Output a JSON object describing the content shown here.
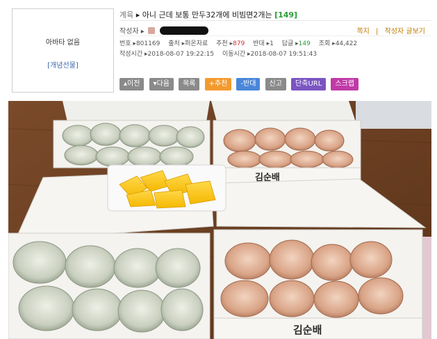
{
  "post": {
    "avatar": {
      "no_avatar": "아바타 없음",
      "gift": "[개념선물]"
    },
    "category": "계육",
    "title": "아니 근데 보통 만두32개에 비빔면2개는",
    "comment_count": "[149]",
    "author_label": "작성자",
    "author_links": {
      "message": "쪽지",
      "posts": "작성자 글보기"
    },
    "info": {
      "number_label": "번호",
      "number": "801169",
      "source_label": "출처",
      "source": "퍼온자료",
      "upvote_label": "추천",
      "upvotes": "879",
      "downvote_label": "반대",
      "downvotes": "1",
      "reply_label": "답글",
      "replies": "149",
      "views_label": "조회",
      "views": "44,422",
      "created_label": "작성시간",
      "created": "2018-08-07 19:22:15",
      "moved_label": "이동시간",
      "moved": "2018-08-07 19:51:43"
    },
    "buttons": {
      "prev": "이전",
      "next": "다음",
      "list": "목록",
      "recommend": "+추천",
      "oppose": "-반대",
      "report": "신고",
      "short_url": "단축URL",
      "scrap": "스크랩"
    }
  },
  "photo": {
    "box_brand": "김순배"
  },
  "colors": {
    "title_comment": "#2a9d3a",
    "author_links": "#c07a00",
    "recommend_button": "#f39a2e",
    "oppose_button": "#4a86d9",
    "short_url_button": "#7a55c2",
    "scrap_button": "#c03aa8"
  }
}
